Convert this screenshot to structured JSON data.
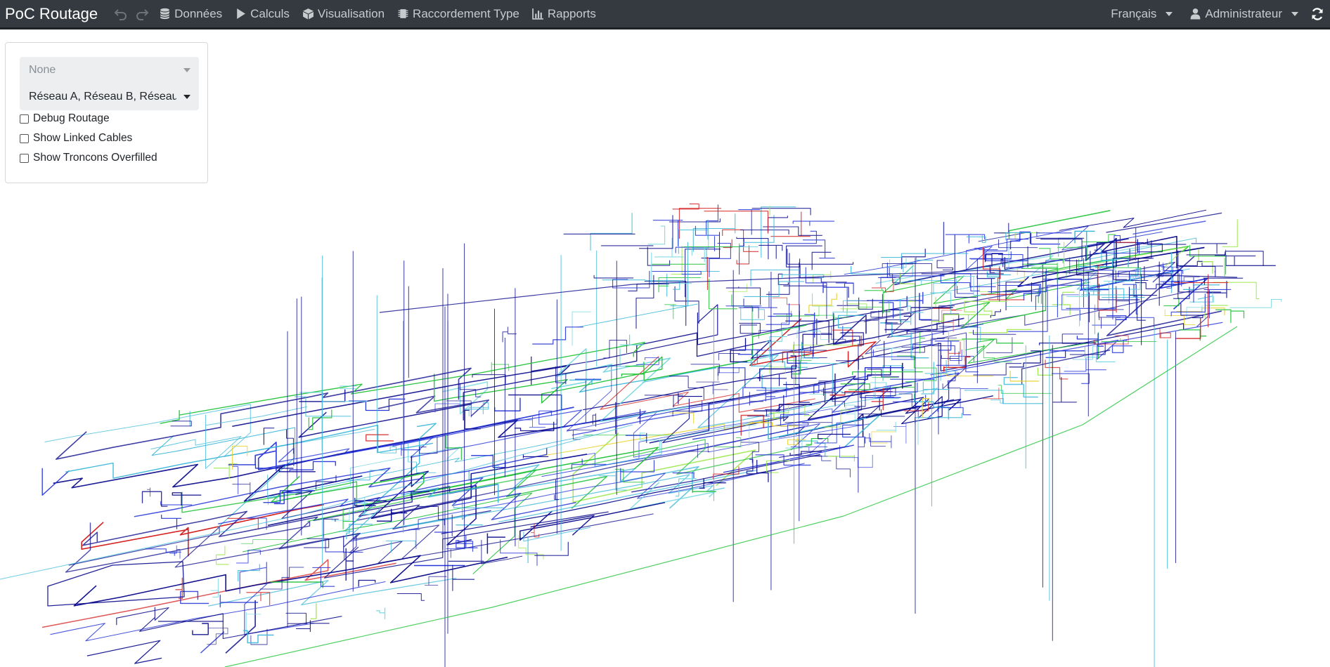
{
  "navbar": {
    "brand": "PoC Routage",
    "undo_icon": "undo-icon",
    "redo_icon": "redo-icon",
    "menu": [
      {
        "label": "Données",
        "icon": "database-icon"
      },
      {
        "label": "Calculs",
        "icon": "play-icon"
      },
      {
        "label": "Visualisation",
        "icon": "cube-icon"
      },
      {
        "label": "Raccordement Type",
        "icon": "chip-icon"
      },
      {
        "label": "Rapports",
        "icon": "bar-chart-icon"
      }
    ],
    "language": "Français",
    "user": "Administrateur",
    "refresh_icon": "refresh-icon"
  },
  "panel": {
    "select_placeholder": "None",
    "select_networks": "Réseau A, Réseau B, Réseau C",
    "checkboxes": [
      {
        "label": "Debug Routage",
        "checked": false
      },
      {
        "label": "Show Linked Cables",
        "checked": false
      },
      {
        "label": "Show Troncons Overfilled",
        "checked": false
      }
    ]
  },
  "colors": {
    "navbar_bg": "#343a40",
    "cable_palette": [
      "#0a0a8c",
      "#1f2fd6",
      "#3ab7d8",
      "#6fd6e0",
      "#22c33a",
      "#9be84a",
      "#d41f1f",
      "#e8d22a"
    ]
  }
}
